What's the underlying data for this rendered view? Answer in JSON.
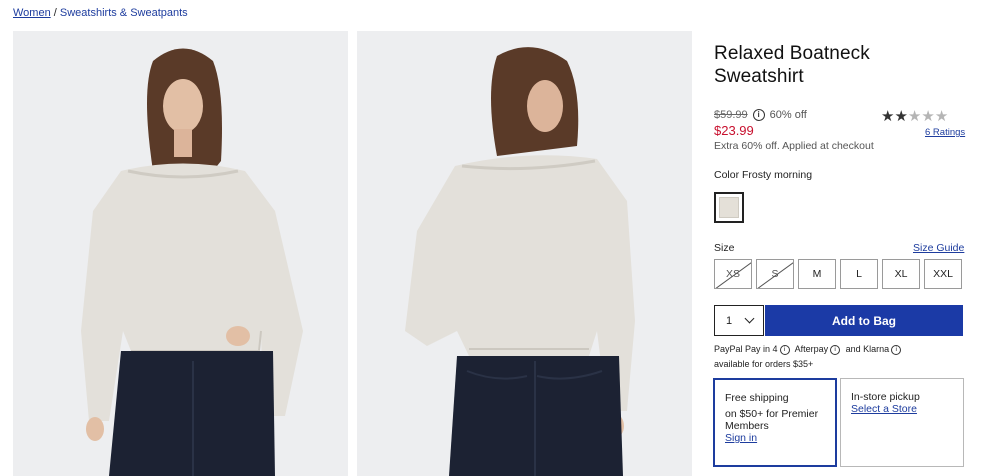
{
  "breadcrumb": {
    "items": [
      "Women",
      "Sweatshirts & Sweatpants"
    ],
    "separator": "/"
  },
  "product": {
    "title_line1": "Relaxed Boatneck",
    "title_line2": "Sweatshirt",
    "original_price": "$59.99",
    "discount": "60% off",
    "sale_price": "$23.99",
    "extra_note": "Extra 60% off. Applied at checkout",
    "rating": 2,
    "rating_max": 5,
    "ratings_link": "6 Ratings"
  },
  "color": {
    "label": "Color Frosty morning",
    "swatch_hex": "#e4e0d8"
  },
  "size": {
    "label": "Size",
    "guide_link": "Size Guide",
    "options": [
      {
        "label": "XS",
        "available": false
      },
      {
        "label": "S",
        "available": false
      },
      {
        "label": "M",
        "available": true
      },
      {
        "label": "L",
        "available": true
      },
      {
        "label": "XL",
        "available": true
      },
      {
        "label": "XXL",
        "available": true
      }
    ]
  },
  "purchase": {
    "quantity": "1",
    "add_button": "Add to Bag"
  },
  "payments": {
    "paypal": "PayPal Pay in 4",
    "afterpay": "Afterpay",
    "and": "and",
    "klarna": "Klarna",
    "availability": "available for orders $35+"
  },
  "fulfillment": {
    "shipping_title": "Free shipping",
    "shipping_desc": "on $50+ for Premier Members",
    "shipping_link": "Sign in",
    "pickup_title": "In-store pickup",
    "pickup_link": "Select a Store"
  },
  "colors": {
    "accent": "#1b3aa6",
    "sale": "#c8102e"
  },
  "icons": [
    "info-icon",
    "star-icon",
    "chevron-down-icon"
  ]
}
